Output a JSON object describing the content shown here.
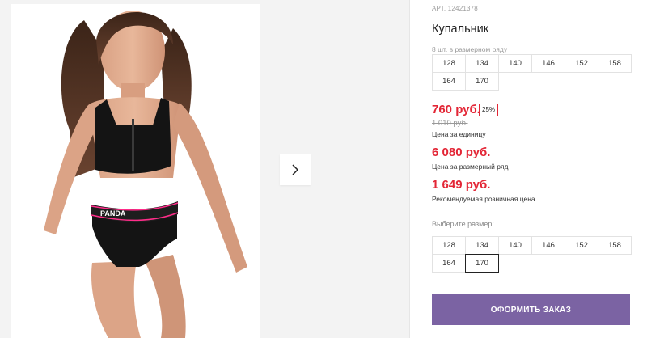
{
  "product": {
    "article": "АРТ. 12421378",
    "title": "Купальник",
    "pack_note": "8 шт. в размерном ряду",
    "pack_sizes": [
      "128",
      "134",
      "140",
      "146",
      "152",
      "158",
      "164",
      "170"
    ]
  },
  "pricing": {
    "unit_price": "760 руб.",
    "discount": "25%",
    "old_price": "1 010 руб.",
    "unit_label": "Цена за единицу",
    "pack_price": "6 080 руб.",
    "pack_label": "Цена за размерный ряд",
    "retail_price": "1 649 руб.",
    "retail_label": "Рекомендуемая розничная цена"
  },
  "size_selector": {
    "label": "Выберите размер:",
    "sizes": [
      "128",
      "134",
      "140",
      "146",
      "152",
      "158",
      "164",
      "170"
    ],
    "selected": "170"
  },
  "actions": {
    "order_label": "ОФОРМИТЬ ЗАКАЗ"
  },
  "gallery": {
    "photo_alt": "product-photo",
    "brand_text": "PANDA",
    "next_icon": "chevron-right-icon"
  },
  "colors": {
    "accent": "#7b63a3",
    "price_red": "#e32636",
    "waistband_pink": "#ff2d8a"
  }
}
